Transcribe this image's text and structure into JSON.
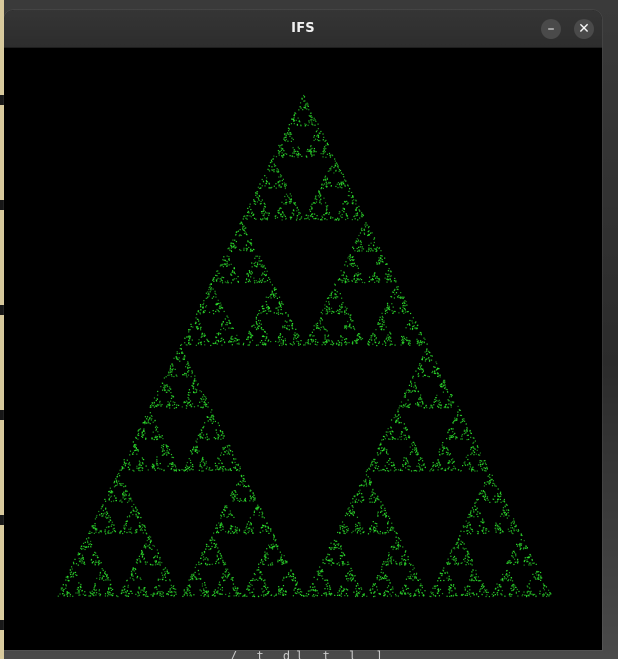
{
  "window": {
    "title": "IFS"
  },
  "titlebar": {
    "minimize_symbol": "–",
    "close_symbol": "✕"
  },
  "fractal": {
    "type": "sierpinski-triangle",
    "point_color": "#2ee32e",
    "background": "#000000",
    "iterations": 5
  },
  "desktop": {
    "snippet": "/ t dl t l ]"
  }
}
